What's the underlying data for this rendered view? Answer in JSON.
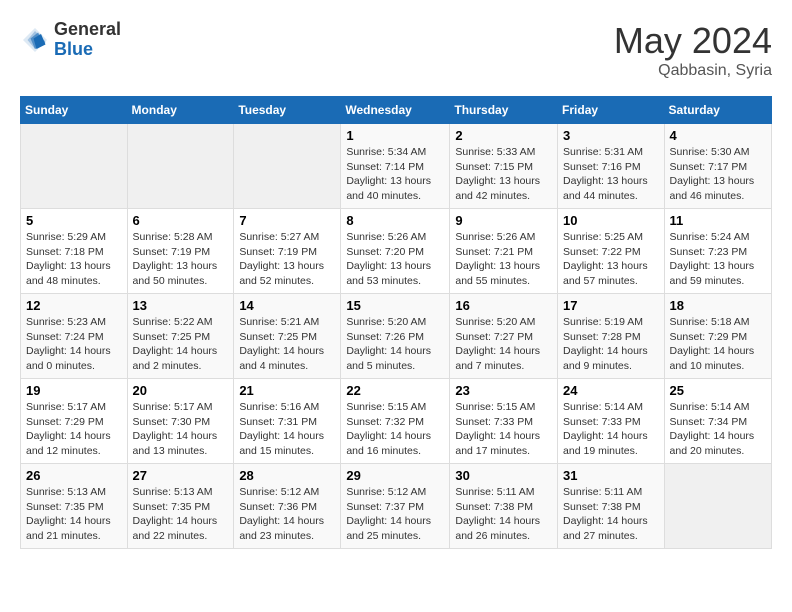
{
  "header": {
    "logo_general": "General",
    "logo_blue": "Blue",
    "month_title": "May 2024",
    "location": "Qabbasin, Syria"
  },
  "weekdays": [
    "Sunday",
    "Monday",
    "Tuesday",
    "Wednesday",
    "Thursday",
    "Friday",
    "Saturday"
  ],
  "weeks": [
    [
      {
        "day": "",
        "info": ""
      },
      {
        "day": "",
        "info": ""
      },
      {
        "day": "",
        "info": ""
      },
      {
        "day": "1",
        "info": "Sunrise: 5:34 AM\nSunset: 7:14 PM\nDaylight: 13 hours\nand 40 minutes."
      },
      {
        "day": "2",
        "info": "Sunrise: 5:33 AM\nSunset: 7:15 PM\nDaylight: 13 hours\nand 42 minutes."
      },
      {
        "day": "3",
        "info": "Sunrise: 5:31 AM\nSunset: 7:16 PM\nDaylight: 13 hours\nand 44 minutes."
      },
      {
        "day": "4",
        "info": "Sunrise: 5:30 AM\nSunset: 7:17 PM\nDaylight: 13 hours\nand 46 minutes."
      }
    ],
    [
      {
        "day": "5",
        "info": "Sunrise: 5:29 AM\nSunset: 7:18 PM\nDaylight: 13 hours\nand 48 minutes."
      },
      {
        "day": "6",
        "info": "Sunrise: 5:28 AM\nSunset: 7:19 PM\nDaylight: 13 hours\nand 50 minutes."
      },
      {
        "day": "7",
        "info": "Sunrise: 5:27 AM\nSunset: 7:19 PM\nDaylight: 13 hours\nand 52 minutes."
      },
      {
        "day": "8",
        "info": "Sunrise: 5:26 AM\nSunset: 7:20 PM\nDaylight: 13 hours\nand 53 minutes."
      },
      {
        "day": "9",
        "info": "Sunrise: 5:26 AM\nSunset: 7:21 PM\nDaylight: 13 hours\nand 55 minutes."
      },
      {
        "day": "10",
        "info": "Sunrise: 5:25 AM\nSunset: 7:22 PM\nDaylight: 13 hours\nand 57 minutes."
      },
      {
        "day": "11",
        "info": "Sunrise: 5:24 AM\nSunset: 7:23 PM\nDaylight: 13 hours\nand 59 minutes."
      }
    ],
    [
      {
        "day": "12",
        "info": "Sunrise: 5:23 AM\nSunset: 7:24 PM\nDaylight: 14 hours\nand 0 minutes."
      },
      {
        "day": "13",
        "info": "Sunrise: 5:22 AM\nSunset: 7:25 PM\nDaylight: 14 hours\nand 2 minutes."
      },
      {
        "day": "14",
        "info": "Sunrise: 5:21 AM\nSunset: 7:25 PM\nDaylight: 14 hours\nand 4 minutes."
      },
      {
        "day": "15",
        "info": "Sunrise: 5:20 AM\nSunset: 7:26 PM\nDaylight: 14 hours\nand 5 minutes."
      },
      {
        "day": "16",
        "info": "Sunrise: 5:20 AM\nSunset: 7:27 PM\nDaylight: 14 hours\nand 7 minutes."
      },
      {
        "day": "17",
        "info": "Sunrise: 5:19 AM\nSunset: 7:28 PM\nDaylight: 14 hours\nand 9 minutes."
      },
      {
        "day": "18",
        "info": "Sunrise: 5:18 AM\nSunset: 7:29 PM\nDaylight: 14 hours\nand 10 minutes."
      }
    ],
    [
      {
        "day": "19",
        "info": "Sunrise: 5:17 AM\nSunset: 7:29 PM\nDaylight: 14 hours\nand 12 minutes."
      },
      {
        "day": "20",
        "info": "Sunrise: 5:17 AM\nSunset: 7:30 PM\nDaylight: 14 hours\nand 13 minutes."
      },
      {
        "day": "21",
        "info": "Sunrise: 5:16 AM\nSunset: 7:31 PM\nDaylight: 14 hours\nand 15 minutes."
      },
      {
        "day": "22",
        "info": "Sunrise: 5:15 AM\nSunset: 7:32 PM\nDaylight: 14 hours\nand 16 minutes."
      },
      {
        "day": "23",
        "info": "Sunrise: 5:15 AM\nSunset: 7:33 PM\nDaylight: 14 hours\nand 17 minutes."
      },
      {
        "day": "24",
        "info": "Sunrise: 5:14 AM\nSunset: 7:33 PM\nDaylight: 14 hours\nand 19 minutes."
      },
      {
        "day": "25",
        "info": "Sunrise: 5:14 AM\nSunset: 7:34 PM\nDaylight: 14 hours\nand 20 minutes."
      }
    ],
    [
      {
        "day": "26",
        "info": "Sunrise: 5:13 AM\nSunset: 7:35 PM\nDaylight: 14 hours\nand 21 minutes."
      },
      {
        "day": "27",
        "info": "Sunrise: 5:13 AM\nSunset: 7:35 PM\nDaylight: 14 hours\nand 22 minutes."
      },
      {
        "day": "28",
        "info": "Sunrise: 5:12 AM\nSunset: 7:36 PM\nDaylight: 14 hours\nand 23 minutes."
      },
      {
        "day": "29",
        "info": "Sunrise: 5:12 AM\nSunset: 7:37 PM\nDaylight: 14 hours\nand 25 minutes."
      },
      {
        "day": "30",
        "info": "Sunrise: 5:11 AM\nSunset: 7:38 PM\nDaylight: 14 hours\nand 26 minutes."
      },
      {
        "day": "31",
        "info": "Sunrise: 5:11 AM\nSunset: 7:38 PM\nDaylight: 14 hours\nand 27 minutes."
      },
      {
        "day": "",
        "info": ""
      }
    ]
  ]
}
